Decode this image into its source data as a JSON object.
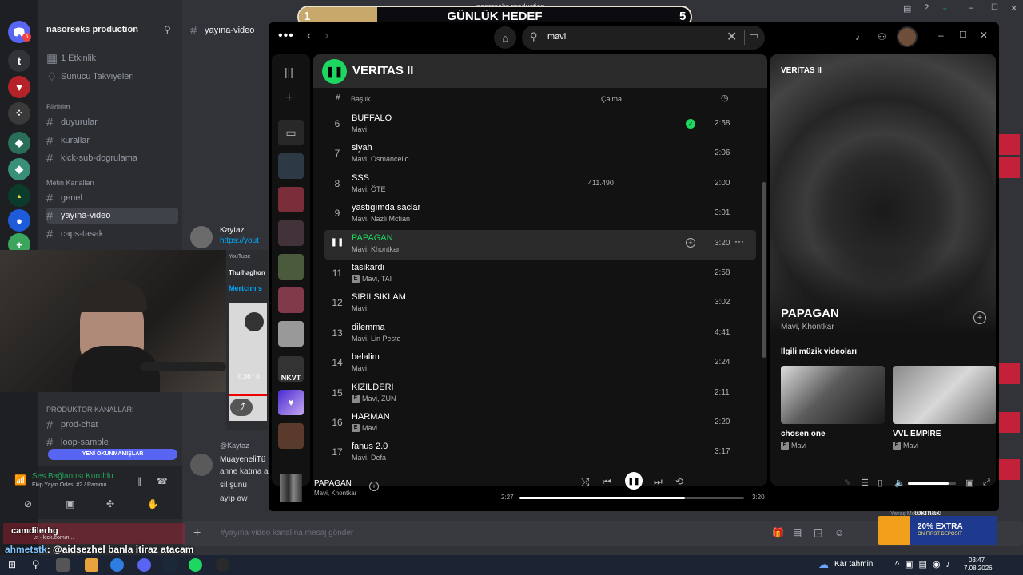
{
  "discord": {
    "server_name": "nasorseks production",
    "channel_header": "yayına-video",
    "sidebar_top": [
      "1 Etkinlik",
      "Sunucu Takviyeleri"
    ],
    "categories": [
      {
        "name": "Bildirim",
        "channels": [
          "duyurular",
          "kurallar",
          "kick-sub-dogrulama"
        ]
      },
      {
        "name": "Metin Kanalları",
        "channels": [
          "genel",
          "yayına-video",
          "caps-tasak"
        ]
      },
      {
        "name": "PRODÜKTÖR KANALLARI",
        "channels": [
          "prod-chat",
          "loop-sample"
        ]
      }
    ],
    "unread_banner": "YENİ OKUNMAMIŞLAR",
    "voice_status": "Ses Bağlantısı Kuruldu",
    "voice_channel": "Ekip Yayın Odası #2 / Rammu...",
    "message_placeholder": "#yayına-video kanalına mesaj gönder",
    "chat_user": "Kaytaz",
    "chat_link": "https://yout",
    "chat_user2": "@Kaytaz",
    "chat_user3": "MuayeneliTü",
    "chat_lines": [
      "anne katma a",
      "sil şunu",
      "ayıp aw"
    ],
    "chat_alert": "Mertcim s",
    "youtube_label": "YouTube",
    "youtube_channel": "Thulhaghon",
    "video_time": "0:36 / 0",
    "voice_user": "Yavaş Moddan Muaf",
    "voice_user2": "tokmak",
    "stream_user": "camdilerhg",
    "stream_sub": "♫ · kick.com/n...",
    "server_initial": "t",
    "server_badge": "5"
  },
  "goal": {
    "left_number": "1",
    "title": "GÜNLÜK HEDEF",
    "right_number": "5",
    "progress": 0.2,
    "top_text": "nasorseks production"
  },
  "stream_chat": {
    "user": "ahmetstk",
    "message": ": @aidsezhel banla itiraz atacam"
  },
  "spotify": {
    "search_value": "mavi",
    "playlist_title": "VERITAS II",
    "col_title": "Başlık",
    "col_plays": "Çalma",
    "col_index": "#",
    "tracks": [
      {
        "n": "6",
        "title": "BUFFALO",
        "artists": "Mavi",
        "explicit": false,
        "plays": "",
        "duration": "2:58",
        "saved": true
      },
      {
        "n": "7",
        "title": "siyah",
        "artists": "Mavi, Osmancello",
        "explicit": false,
        "plays": "",
        "duration": "2:06"
      },
      {
        "n": "8",
        "title": "SSS",
        "artists": "Mavi, ÖTE",
        "explicit": false,
        "plays": "411.490",
        "duration": "2:00"
      },
      {
        "n": "9",
        "title": "yastıgımda saclar",
        "artists": "Mavi, Nazli Mcfian",
        "explicit": false,
        "plays": "",
        "duration": "3:01"
      },
      {
        "n": "",
        "title": "PAPAGAN",
        "artists": "Mavi, Khontkar",
        "explicit": false,
        "plays": "",
        "duration": "3:20",
        "playing": true
      },
      {
        "n": "11",
        "title": "tasikardi",
        "artists": "Mavi, TAI",
        "explicit": true,
        "plays": "",
        "duration": "2:58"
      },
      {
        "n": "12",
        "title": "SIRILSIKLAM",
        "artists": "Mavi",
        "explicit": false,
        "plays": "",
        "duration": "3:02"
      },
      {
        "n": "13",
        "title": "dilemma",
        "artists": "Mavi, Lin Pesto",
        "explicit": false,
        "plays": "",
        "duration": "4:41"
      },
      {
        "n": "14",
        "title": "belalim",
        "artists": "Mavi",
        "explicit": false,
        "plays": "",
        "duration": "2:24"
      },
      {
        "n": "15",
        "title": "KIZILDERI",
        "artists": "Mavi, ZUN",
        "explicit": true,
        "plays": "",
        "duration": "2:11"
      },
      {
        "n": "16",
        "title": "HARMAN",
        "artists": "Mavi",
        "explicit": true,
        "plays": "",
        "duration": "2:20"
      },
      {
        "n": "17",
        "title": "fanus 2.0",
        "artists": "Mavi, Defa",
        "explicit": false,
        "plays": "",
        "duration": "3:17"
      }
    ],
    "now_playing": {
      "panel_title": "VERITAS II",
      "track": "PAPAGAN",
      "artists": "Mavi, Khontkar",
      "related_header": "İlgili müzik videoları",
      "videos": [
        {
          "title": "chosen one",
          "artist": "Mavi"
        },
        {
          "title": "VVL EMPIRE",
          "artist": "Mavi"
        }
      ]
    },
    "player": {
      "track": "PAPAGAN",
      "artists": "Mavi, Khontkar",
      "elapsed": "2:27",
      "total": "3:20",
      "progress": 0.735,
      "volume": 0.85
    },
    "library_label": "NKVT"
  },
  "ad": {
    "line1": "20% EXTRA",
    "line2": "ON FIRST DEPOSIT"
  },
  "taskbar": {
    "weather": "Kâr tahmini",
    "time": "03:47",
    "date": "7.08.2026"
  },
  "colors": {
    "spotify_green": "#1ed760",
    "discord_bg": "#313338"
  }
}
